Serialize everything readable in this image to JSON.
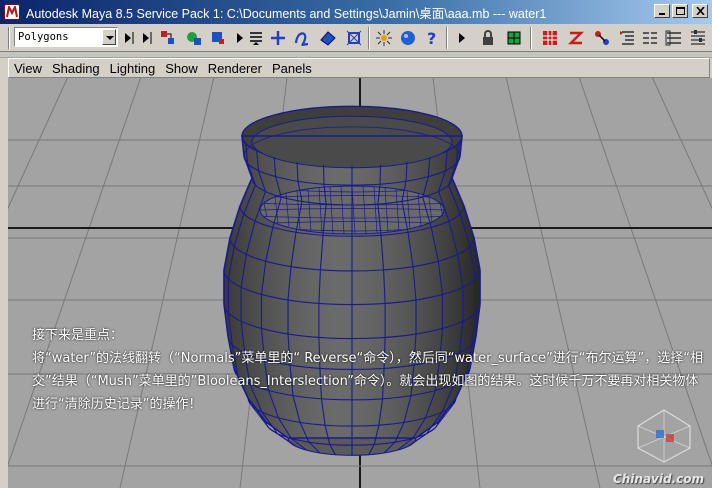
{
  "window": {
    "title": "Autodesk Maya 8.5 Service Pack 1: C:\\Documents and Settings\\Jamin\\桌面\\aaa.mb   ---   water1"
  },
  "toolbar": {
    "mode_select": "Polygons",
    "icons": [
      "select-by-hierarchy-icon",
      "select-by-object-icon",
      "select-by-component-icon",
      "snap-grid-icon",
      "snap-curve-icon",
      "snap-point-icon",
      "snap-surface-icon",
      "history-icon",
      "input-icon",
      "render-icon",
      "ipr-icon",
      "help-icon",
      "lock-icon",
      "layout-icon",
      "hypergraph-icon",
      "hypershade-icon",
      "connection-icon",
      "outliner-icon",
      "attribute-icon"
    ]
  },
  "panel_menu": {
    "items": [
      "View",
      "Shading",
      "Lighting",
      "Show",
      "Renderer",
      "Panels"
    ]
  },
  "caption": {
    "line1": "接下来是重点：",
    "line2": "将“water”的法线翻转（“Normals”菜单里的“ Reverse“命令），然后同“water_surface”进行“布尔运算”，选择“相交”结果（“Mush”菜单里的”Blooleans_Interslection”命令）。就会出现如图的结果。这时候千万不要再对相关物体进行“清除历史记录”的操作！"
  },
  "watermark": {
    "text": "Chinavid.com"
  },
  "colors": {
    "viewport_bg": "#a3a3a3",
    "wire": "#1a1a8c",
    "mesh_fill": "#5a5a5a",
    "grid": "#7a7a7a",
    "grid_axis": "#1a1a1a"
  }
}
